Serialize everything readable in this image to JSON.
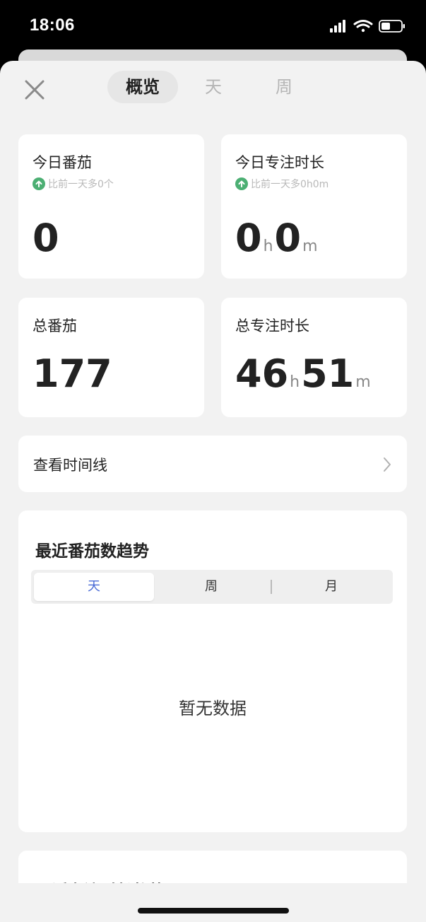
{
  "status_bar": {
    "time": "18:06"
  },
  "tabs": {
    "overview": "概览",
    "day": "天",
    "week": "周"
  },
  "today_pomodoro": {
    "title": "今日番茄",
    "compare": "比前一天多0个",
    "value": "0"
  },
  "today_focus": {
    "title": "今日专注时长",
    "compare": "比前一天多0h0m",
    "hours": "0",
    "minutes": "0",
    "unit_h": "h",
    "unit_m": "m"
  },
  "total_pomodoro": {
    "title": "总番茄",
    "value": "177"
  },
  "total_focus": {
    "title": "总专注时长",
    "hours": "46",
    "minutes": "51",
    "unit_h": "h",
    "unit_m": "m"
  },
  "timeline_link": {
    "label": "查看时间线"
  },
  "pomodoro_trend": {
    "title": "最近番茄数趋势",
    "options": [
      "天",
      "周",
      "月"
    ],
    "selected": "天",
    "empty": "暂无数据"
  },
  "focus_trend": {
    "title": "最近专注时长趋势"
  },
  "colors": {
    "accent": "#4a6bd6",
    "up_green": "#4caf73",
    "background": "#f2f2f2"
  },
  "icons": [
    "signal-icon",
    "wifi-icon",
    "battery-icon",
    "close-icon",
    "arrow-up-icon",
    "chevron-right-icon"
  ]
}
